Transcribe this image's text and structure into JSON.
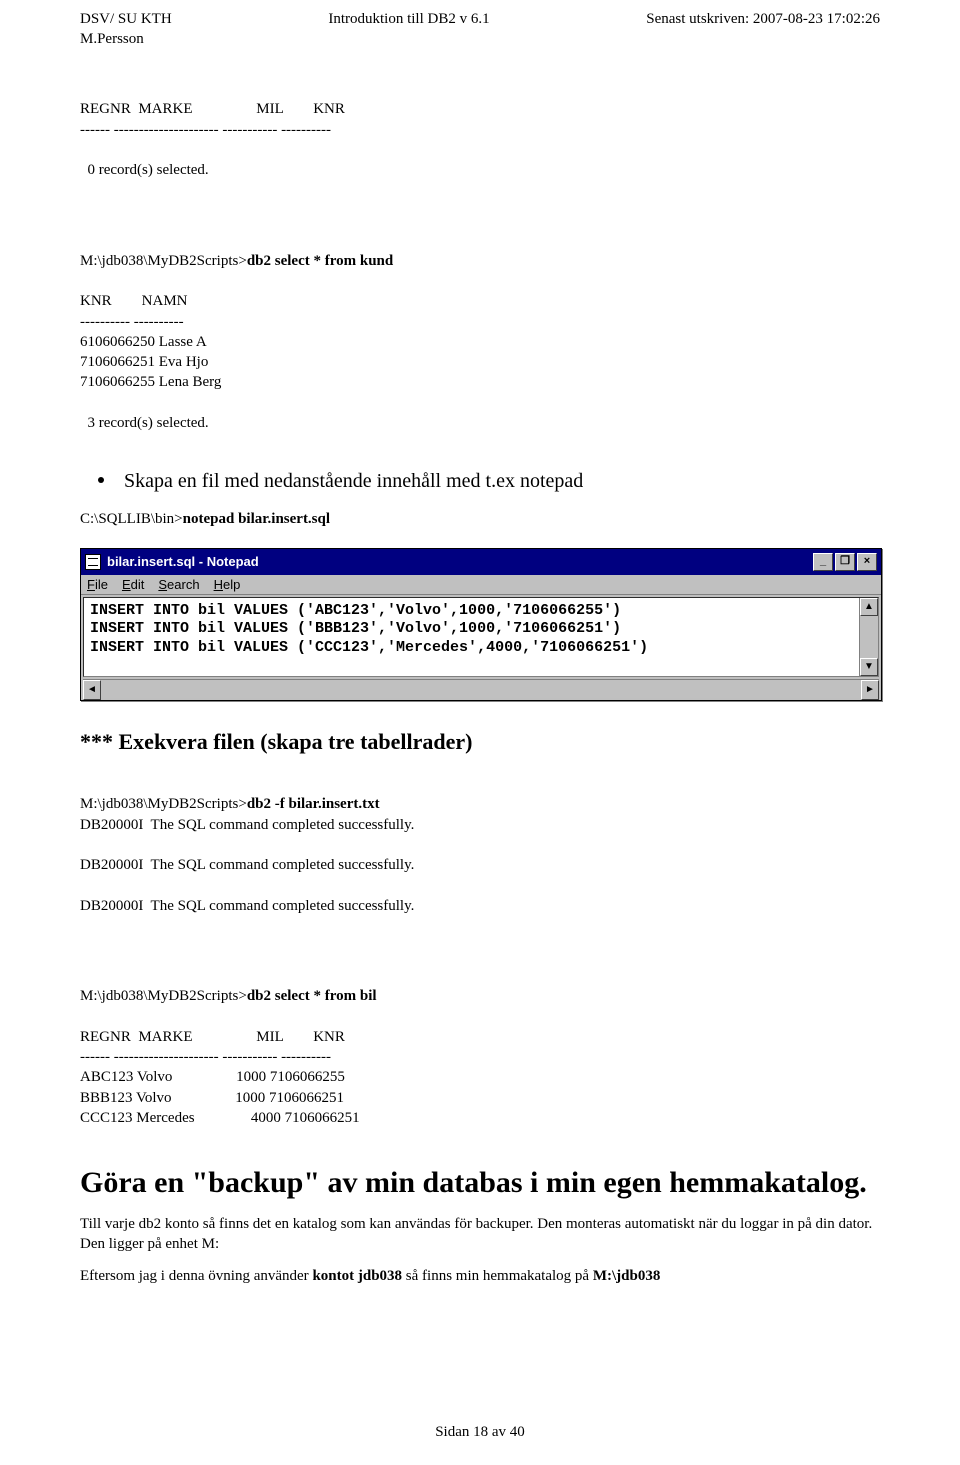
{
  "header": {
    "left_line1": "DSV/ SU KTH",
    "left_line2": "M.Persson",
    "center": "Introduktion till DB2 v 6.1",
    "right": "Senast utskriven: 2007-08-23 17:02:26"
  },
  "block1": {
    "line1_cols": "REGNR  MARKE                 MIL        KNR",
    "line2_sep": "------ --------------------- ----------- ----------",
    "line3_records": "  0 record(s) selected."
  },
  "block2": {
    "cmd_prefix": "M:\\jdb038\\MyDB2Scripts>",
    "cmd_bold": "db2 select * from kund",
    "cols": "KNR        NAMN",
    "sep": "---------- ----------",
    "r1": "6106066250 Lasse A",
    "r2": "7106066251 Eva Hjo",
    "r3": "7106066255 Lena Berg",
    "rec": "  3 record(s) selected."
  },
  "bullet_text": "Skapa en fil med nedanstående innehåll med t.ex notepad",
  "notepad_cmd": {
    "prefix": "C:\\SQLLIB\\bin>",
    "bold": "notepad bilar.insert.sql"
  },
  "notepad": {
    "title": "bilar.insert.sql - Notepad",
    "menus": {
      "file": "File",
      "edit": "Edit",
      "search": "Search",
      "help": "Help"
    },
    "line1": "INSERT INTO bil VALUES ('ABC123','Volvo',1000,'7106066255')",
    "line2": "INSERT INTO bil VALUES ('BBB123','Volvo',1000,'7106066251')",
    "line3": "INSERT INTO bil VALUES ('CCC123','Mercedes',4000,'7106066251')",
    "buttons": {
      "min": "_",
      "max": "❐",
      "close": "×",
      "up": "▲",
      "down": "▼",
      "left": "◄",
      "right": "►"
    }
  },
  "exec": {
    "title": "*** Exekvera filen (skapa tre tabellrader)",
    "cmd_prefix": "M:\\jdb038\\MyDB2Scripts>",
    "cmd_bold": "db2 -f bilar.insert.txt",
    "msg": "DB20000I  The SQL command completed successfully."
  },
  "select_bil": {
    "cmd_prefix": "M:\\jdb038\\MyDB2Scripts>",
    "cmd_bold": "db2 select * from bil",
    "cols": "REGNR  MARKE                 MIL        KNR",
    "sep": "------ --------------------- ----------- ----------",
    "r1": "ABC123 Volvo                 1000 7106066255",
    "r2": "BBB123 Volvo                 1000 7106066251",
    "r3": "CCC123 Mercedes               4000 7106066251"
  },
  "backup": {
    "title": "Göra en \"backup\" av min databas i min egen hemmakatalog.",
    "para1": "Till varje db2 konto så finns det en katalog som kan användas för backuper. Den monteras automatiskt när du loggar in på din dator. Den ligger på enhet M:",
    "para2_prefix": "Eftersom jag i denna övning använder ",
    "para2_bold1": "kontot jdb038",
    "para2_mid": " så finns min hemmakatalog på ",
    "para2_bold2": "M:\\jdb038"
  },
  "footer": "Sidan 18 av 40"
}
